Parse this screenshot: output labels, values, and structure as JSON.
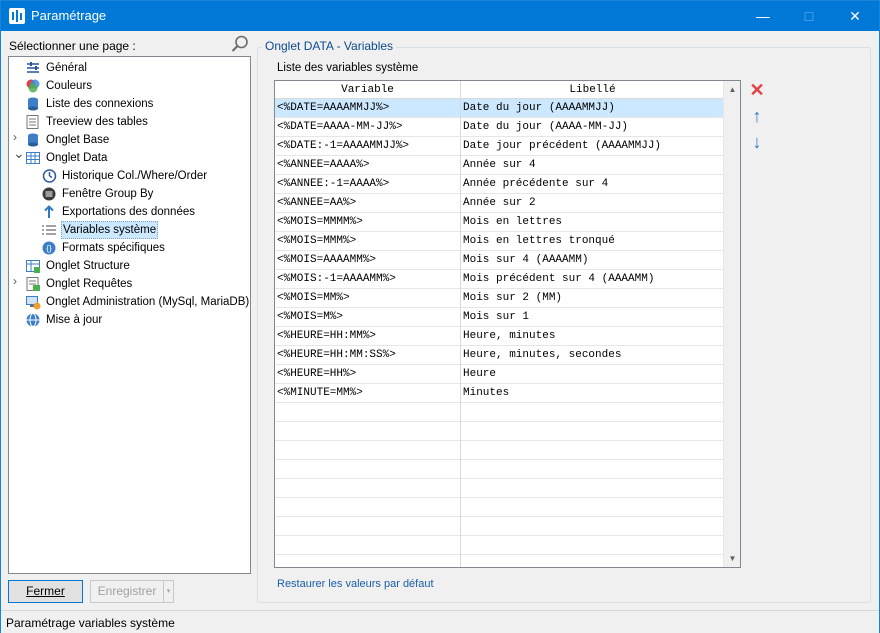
{
  "window": {
    "title": "Paramétrage",
    "minimize_glyph": "—",
    "maximize_glyph": "□",
    "close_glyph": "✕"
  },
  "left": {
    "label": "Sélectionner une page :",
    "tree": [
      {
        "label": "Général",
        "icon": "general-settings-icon",
        "level": 0
      },
      {
        "label": "Couleurs",
        "icon": "colors-icon",
        "level": 0
      },
      {
        "label": "Liste des connexions",
        "icon": "connections-list-icon",
        "level": 0
      },
      {
        "label": "Treeview des tables",
        "icon": "treeview-tables-icon",
        "level": 0
      },
      {
        "label": "Onglet Base",
        "icon": "database-icon",
        "level": 0,
        "expander": "collapsed"
      },
      {
        "label": "Onglet Data",
        "icon": "data-grid-icon",
        "level": 0,
        "expander": "expanded"
      },
      {
        "label": "Historique Col./Where/Order",
        "icon": "history-icon",
        "level": 1
      },
      {
        "label": "Fenêtre Group By",
        "icon": "group-by-icon",
        "level": 1
      },
      {
        "label": "Exportations des données",
        "icon": "export-icon",
        "level": 1
      },
      {
        "label": "Variables système",
        "icon": "system-variables-icon",
        "level": 1,
        "selected": true
      },
      {
        "label": "Formats spécifiques",
        "icon": "formats-icon",
        "level": 1
      },
      {
        "label": "Onglet Structure",
        "icon": "structure-icon",
        "level": 0
      },
      {
        "label": "Onglet Requêtes",
        "icon": "queries-icon",
        "level": 0,
        "expander": "collapsed"
      },
      {
        "label": "Onglet Administration (MySql, MariaDB)",
        "icon": "administration-icon",
        "level": 0
      },
      {
        "label": "Mise à jour",
        "icon": "update-globe-icon",
        "level": 0
      }
    ]
  },
  "buttons": {
    "close": "Fermer",
    "save": "Enregistrer"
  },
  "group": {
    "title": "Onglet DATA - Variables",
    "list_label": "Liste des variables système",
    "columns": {
      "variable": "Variable",
      "libelle": "Libellé"
    },
    "rows": [
      {
        "variable": "<%DATE=AAAAMMJJ%>",
        "libelle": "Date du jour (AAAAMMJJ)",
        "selected": true
      },
      {
        "variable": "<%DATE=AAAA-MM-JJ%>",
        "libelle": "Date du jour (AAAA-MM-JJ)"
      },
      {
        "variable": "<%DATE:-1=AAAAMMJJ%>",
        "libelle": "Date jour précédent (AAAAMMJJ)"
      },
      {
        "variable": "<%ANNEE=AAAA%>",
        "libelle": "Année sur 4"
      },
      {
        "variable": "<%ANNEE:-1=AAAA%>",
        "libelle": "Année précédente sur 4"
      },
      {
        "variable": "<%ANNEE=AA%>",
        "libelle": "Année sur 2"
      },
      {
        "variable": "<%MOIS=MMMM%>",
        "libelle": "Mois en lettres"
      },
      {
        "variable": "<%MOIS=MMM%>",
        "libelle": "Mois en lettres tronqué"
      },
      {
        "variable": "<%MOIS=AAAAMM%>",
        "libelle": "Mois sur 4 (AAAAMM)"
      },
      {
        "variable": "<%MOIS:-1=AAAAMM%>",
        "libelle": "Mois précédent sur 4 (AAAAMM)"
      },
      {
        "variable": "<%MOIS=MM%>",
        "libelle": "Mois sur 2 (MM)"
      },
      {
        "variable": "<%MOIS=M%>",
        "libelle": "Mois sur 1"
      },
      {
        "variable": "<%HEURE=HH:MM%>",
        "libelle": "Heure, minutes"
      },
      {
        "variable": "<%HEURE=HH:MM:SS%>",
        "libelle": "Heure, minutes, secondes"
      },
      {
        "variable": "<%HEURE=HH%>",
        "libelle": "Heure"
      },
      {
        "variable": "<%MINUTE=MM%>",
        "libelle": "Minutes"
      },
      {
        "variable": "",
        "libelle": ""
      },
      {
        "variable": "",
        "libelle": ""
      },
      {
        "variable": "",
        "libelle": ""
      },
      {
        "variable": "",
        "libelle": ""
      },
      {
        "variable": "",
        "libelle": ""
      },
      {
        "variable": "",
        "libelle": ""
      },
      {
        "variable": "",
        "libelle": ""
      },
      {
        "variable": "",
        "libelle": ""
      }
    ],
    "actions": {
      "delete_glyph": "✕",
      "up_glyph": "↑",
      "down_glyph": "↓"
    },
    "restore_link": "Restaurer les valeurs par défaut"
  },
  "status": {
    "text": "Paramétrage variables système"
  },
  "colors": {
    "titlebar": "#0078d7",
    "selection": "#cce8ff",
    "group_title": "#0b4a8f",
    "link": "#1a5ea9",
    "delete": "#e04343",
    "arrow": "#2b79c7"
  }
}
